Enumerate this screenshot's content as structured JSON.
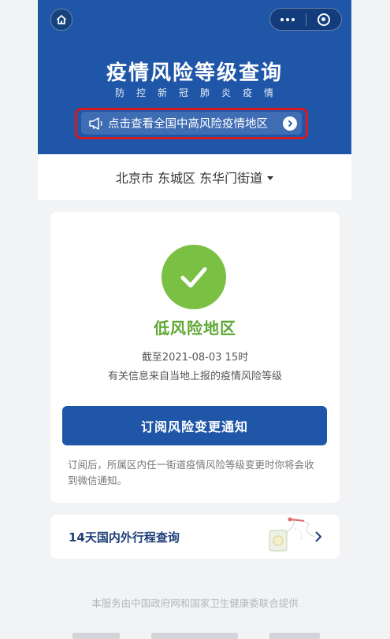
{
  "header": {
    "title": "疫情风险等级查询",
    "subtitle": "防控新冠肺炎疫情",
    "notice_text": "点击查看全国中高风险疫情地区",
    "brand_color": "#1f56a8",
    "highlight_color": "#d71920"
  },
  "location": {
    "text": "北京市 东城区 东华门街道"
  },
  "status": {
    "risk_level": "低风险地区",
    "as_of": "截至2021-08-03 15时",
    "info": "有关信息来自当地上报的疫情风险等级",
    "level_color": "#7ac043"
  },
  "subscribe": {
    "button_label": "订阅风险变更通知",
    "note": "订阅后，所属区内任一街道疫情风险等级变更时你将会收到微信通知。"
  },
  "trip": {
    "label": "14天国内外行程查询"
  },
  "footer": {
    "text": "本服务由中国政府网和国家卫生健康委联合提供"
  },
  "icons": {
    "home": "home-icon",
    "more": "more-dots-icon",
    "close": "target-icon",
    "speaker": "speaker-icon",
    "chevron": "chevron-right-icon",
    "check": "check-icon"
  }
}
